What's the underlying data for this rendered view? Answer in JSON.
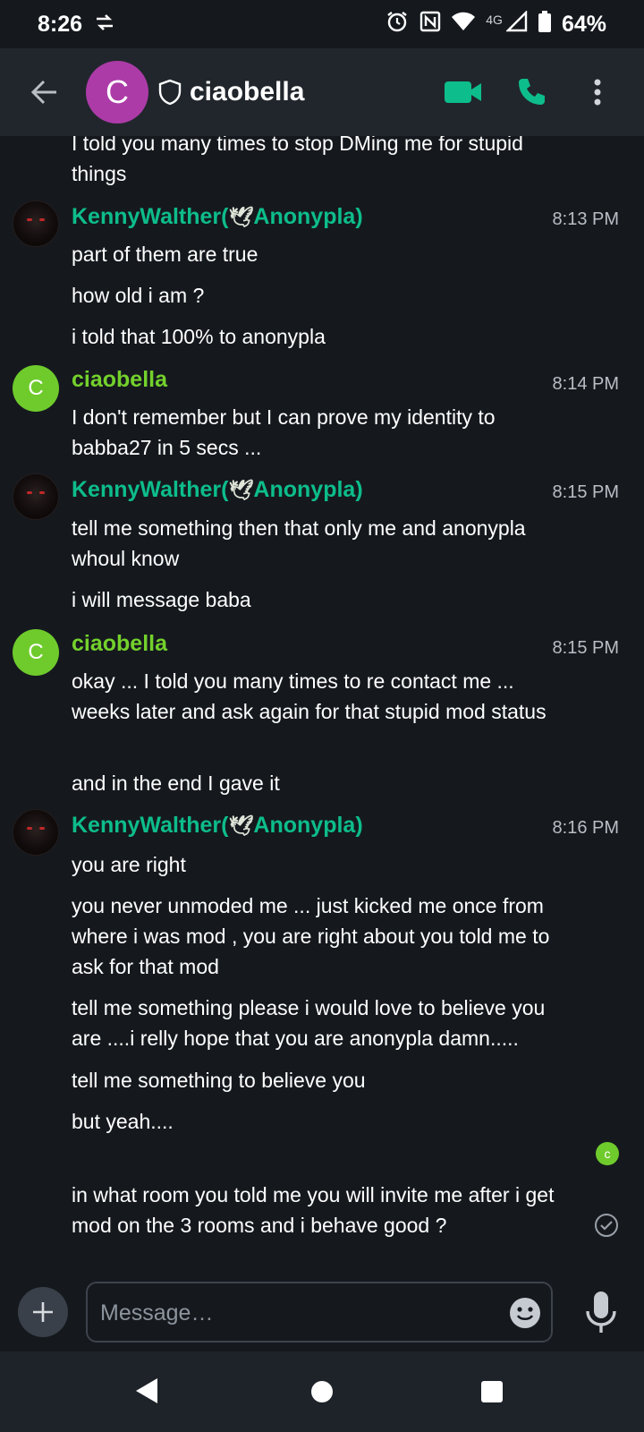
{
  "status_bar": {
    "time": "8:26",
    "network_label": "4G",
    "battery": "64%"
  },
  "header": {
    "avatar_letter": "C",
    "room_name": "ciaobella"
  },
  "timeline": {
    "partial_message": "I told you many times to stop DMing me for stupid things",
    "groups": [
      {
        "sender_prefix": "KennyWalther(",
        "sender_suffix": "Anonypla)",
        "dove": "🕊",
        "time": "8:13 PM",
        "messages": [
          "part of them are true",
          "how old i am ?",
          "i told that 100% to anonypla"
        ]
      },
      {
        "sender": "ciaobella",
        "avatar_letter": "C",
        "time": "8:14 PM",
        "messages": [
          "I don't remember but I can prove my identity to babba27 in 5 secs ..."
        ]
      },
      {
        "sender_prefix": "KennyWalther(",
        "sender_suffix": "Anonypla)",
        "dove": "🕊",
        "time": "8:15 PM",
        "messages": [
          "tell me something then that only me and anonypla whoul know",
          "i will message baba"
        ]
      },
      {
        "sender": "ciaobella",
        "avatar_letter": "C",
        "time": "8:15 PM",
        "messages": [
          "okay ... I told you many times to re contact me ... weeks later and ask again for that stupid mod status",
          "and in the end I gave it"
        ]
      },
      {
        "sender_prefix": "KennyWalther(",
        "sender_suffix": "Anonypla)",
        "dove": "🕊",
        "time": "8:16 PM",
        "messages": [
          "you are right",
          "you never unmoded me ... just kicked me once from where i was mod , you are right about you told me to ask for that mod",
          "tell me something please i would love to believe you are ....i relly hope that you are anonypla damn.....",
          "tell me something to believe you",
          "but yeah....",
          "in what room you told me you will invite me after i get mod on the 3 rooms and i behave good ?"
        ]
      }
    ],
    "read_receipt_letter": "c"
  },
  "composer": {
    "placeholder": "Message…"
  },
  "colors": {
    "accent": "#0dbd8b",
    "ciaobella_name": "#74d12c",
    "header_avatar": "#ac3ba8",
    "background": "#15191e"
  },
  "icons": {
    "back": "arrow-left-icon",
    "shield": "shield-icon",
    "video": "video-call-icon",
    "phone": "phone-icon",
    "menu": "more-vertical-icon",
    "attach": "plus-icon",
    "emoji": "emoji-icon",
    "mic": "microphone-icon"
  }
}
